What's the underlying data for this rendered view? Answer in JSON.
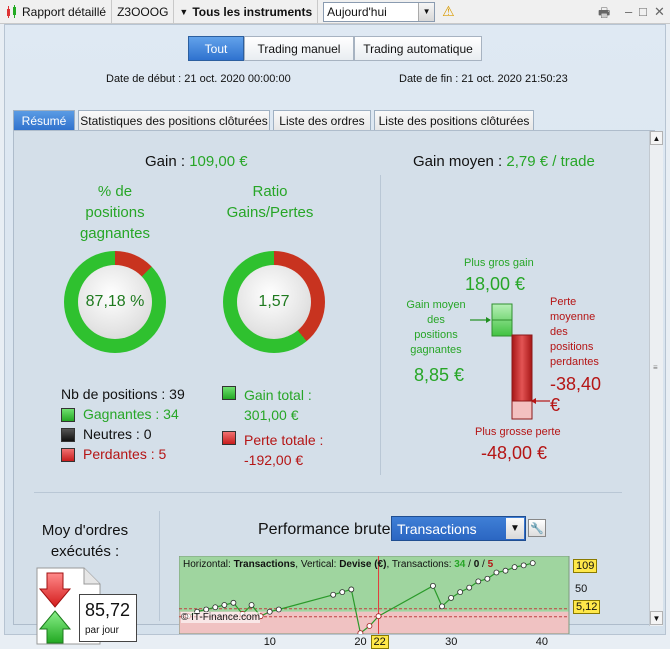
{
  "toolbar": {
    "report_label": "Rapport détaillé",
    "account": "Z3OOOG",
    "instruments": "Tous les instruments",
    "period": "Aujourd'hui"
  },
  "mode_tabs": [
    "Tout",
    "Trading manuel",
    "Trading automatique"
  ],
  "dates": {
    "start": "Date de début :  21 oct. 2020 00:00:00",
    "end": "Date de fin :  21 oct. 2020 21:50:23"
  },
  "tabs": [
    "Résumé",
    "Statistiques des positions clôturées",
    "Liste des ordres",
    "Liste des positions clôturées"
  ],
  "summary": {
    "gain_label": "Gain : ",
    "gain_value": "109,00 €",
    "pct_title": [
      "% de",
      "positions",
      "gagnantes"
    ],
    "pct_value": "87,18 %",
    "pct_fraction": 0.8718,
    "ratio_title": [
      "Ratio",
      "Gains/Pertes"
    ],
    "ratio_value": "1,57",
    "ratio_fraction": 0.6106,
    "nb_positions": "Nb de positions : 39",
    "winners": "Gagnantes : 34",
    "neutral": "Neutres : 0",
    "losers": "Perdantes : 5",
    "gain_total_label": "Gain total :",
    "gain_total_value": "301,00 €",
    "loss_total_label": "Perte totale :",
    "loss_total_value": "-192,00 €"
  },
  "avg_gain": {
    "label": "Gain moyen : ",
    "value": "2,79 € / trade",
    "max_gain_label": "Plus gros gain",
    "max_gain_value": "18,00 €",
    "avg_win_label": [
      "Gain moyen",
      "des",
      "positions",
      "gagnantes"
    ],
    "avg_win_value": "8,85 €",
    "avg_loss_label": [
      "Perte",
      "moyenne",
      "des",
      "positions",
      "perdantes"
    ],
    "avg_loss_value": [
      "-38,40",
      "€"
    ],
    "max_loss_label": "Plus grosse perte",
    "max_loss_value": "-48,00 €"
  },
  "orders": {
    "title": [
      "Moy d'ordres",
      "exécutés :"
    ],
    "value": "85,72",
    "unit": "par jour"
  },
  "performance": {
    "title": "Performance brute",
    "dropdown": "Transactions",
    "header": [
      "Horizontal: ",
      "Transactions",
      ", Vertical: ",
      "Devise (€)",
      ", Transactions: ",
      "34",
      " / ",
      "0",
      " / ",
      "5"
    ],
    "copyright": "© IT-Finance.com",
    "marker_x": "22",
    "label_top": "109",
    "label_mid": "5,12"
  },
  "chart_data": {
    "type": "line",
    "x_ticks": [
      "10",
      "20",
      "30",
      "40"
    ],
    "y_ticks": [
      "50"
    ],
    "xlim": [
      0,
      43
    ],
    "ylim": [
      -50,
      125
    ],
    "x": [
      1,
      2,
      3,
      4,
      5,
      6,
      7,
      8,
      9,
      10,
      11,
      17,
      18,
      19,
      20,
      21,
      22,
      28,
      29,
      30,
      31,
      32,
      33,
      34,
      35,
      36,
      37,
      38,
      39
    ],
    "y": [
      -10,
      0,
      5,
      10,
      15,
      20,
      -5,
      15,
      -10,
      0,
      5,
      38,
      44,
      50,
      -48,
      -32,
      -10,
      58,
      12,
      31,
      44,
      54,
      68,
      74,
      88,
      92,
      100,
      104,
      109
    ],
    "marker_x": 22,
    "colors": {
      "line": "#2a9a2a",
      "positive_band": "#9fd59f",
      "negative_band": "#f0c2c2",
      "marker": "#e23b3b"
    }
  }
}
